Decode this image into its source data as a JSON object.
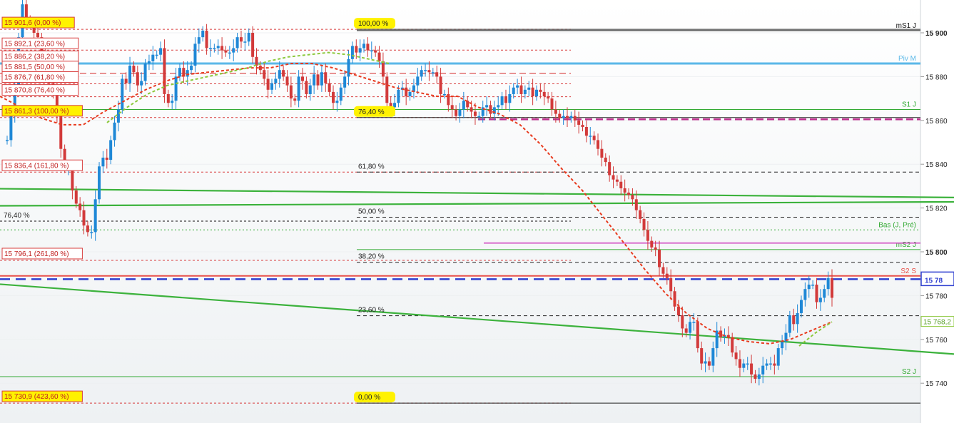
{
  "chart_data": {
    "type": "candlestick",
    "ylim": [
      15730,
      15918
    ],
    "y_ticks": [
      {
        "value": 15900,
        "label": "15 900",
        "bold": true
      },
      {
        "value": 15880,
        "label": "15 880",
        "bold": false
      },
      {
        "value": 15860,
        "label": "15 860",
        "bold": false
      },
      {
        "value": 15840,
        "label": "15 840",
        "bold": false
      },
      {
        "value": 15820,
        "label": "15 820",
        "bold": false
      },
      {
        "value": 15800,
        "label": "15 800",
        "bold": true
      },
      {
        "value": 15780,
        "label": "15 780",
        "bold": false
      },
      {
        "value": 15760,
        "label": "15 760",
        "bold": false
      },
      {
        "value": 15740,
        "label": "15 740",
        "bold": false
      }
    ],
    "current_price_label": "15 78",
    "ma_end_label": "15 768,2",
    "pivot_levels": [
      {
        "name": "mS1 J",
        "value": 15901,
        "color": "#111111"
      },
      {
        "name": "Piv M",
        "value": 15886,
        "color": "#5bb8e8"
      },
      {
        "name": "S1 J",
        "value": 15865,
        "color": "#33aa33"
      },
      {
        "name": "Bas (J, Pré)",
        "value": 15810,
        "color": "#33aa33"
      },
      {
        "name": "mS2 J",
        "value": 15801,
        "color": "#33aa33"
      },
      {
        "name": "S2 S",
        "value": 15789,
        "color": "#e8504a"
      },
      {
        "name": "S2 J",
        "value": 15743,
        "color": "#33aa33"
      }
    ],
    "fib_left_labels": [
      {
        "text": "15 901,6 (0,00 %)",
        "value": 15901.6,
        "highlight": true
      },
      {
        "text": "15 892,1 (23,60 %)",
        "value": 15892.1,
        "highlight": false
      },
      {
        "text": "15 886,2 (38,20 %)",
        "value": 15886.2,
        "highlight": false
      },
      {
        "text": "15 881,5 (50,00 %)",
        "value": 15881.5,
        "highlight": false
      },
      {
        "text": "15 876,7 (61,80 %)",
        "value": 15876.7,
        "highlight": false
      },
      {
        "text": "15 870,8 (76,40 %)",
        "value": 15870.8,
        "highlight": false
      },
      {
        "text": "15 861,3 (100,00 %)",
        "value": 15861.3,
        "highlight": true
      },
      {
        "text": "15 836,4 (161,80 %)",
        "value": 15836.4,
        "highlight": false
      },
      {
        "text": "15 796,1 (261,80 %)",
        "value": 15796.1,
        "highlight": false
      },
      {
        "text": "15 730,9 (423,60 %)",
        "value": 15730.9,
        "highlight": true
      }
    ],
    "fib_mid_labels": [
      {
        "text": "100,00 %",
        "value": 15901.6,
        "highlight": true
      },
      {
        "text": "76,40 %",
        "value": 15861.3,
        "highlight": true
      },
      {
        "text": "61,80 %",
        "value": 15836.4,
        "highlight": false
      },
      {
        "text": "50,00 %",
        "value": 15815.8,
        "highlight": false
      },
      {
        "text": "38,20 %",
        "value": 15795.2,
        "highlight": false
      },
      {
        "text": "23,60 %",
        "value": 15770.8,
        "highlight": false
      },
      {
        "text": "0,00 %",
        "value": 15730.9,
        "highlight": true
      }
    ],
    "left_extra_label": {
      "text": "76,40 %",
      "value": 15814.0
    },
    "trendlines": [
      {
        "from": [
          0,
          15828.8
        ],
        "to": [
          1,
          15824.8
        ]
      },
      {
        "from": [
          0,
          15821.0
        ],
        "to": [
          1,
          15822.8
        ]
      },
      {
        "from": [
          0,
          15785.2
        ],
        "to": [
          1,
          15753.3
        ]
      }
    ],
    "series": [
      {
        "name": "candles",
        "open": [
          15851,
          15851,
          15863,
          15874,
          15898,
          15913,
          15906,
          15904,
          15900,
          15898,
          15891,
          15884,
          15877,
          15872,
          15862,
          15847,
          15838,
          15838,
          15828,
          15822,
          15819,
          15812,
          15809,
          15809,
          15824,
          15839,
          15843,
          15842,
          15851,
          15859,
          15865,
          15879,
          15877,
          15885,
          15882,
          15876,
          15878,
          15886,
          15887,
          15890,
          15890,
          15893,
          15872,
          15868,
          15869,
          15880,
          15884,
          15880,
          15883,
          15885,
          15895,
          15898,
          15901,
          15893,
          15893,
          15893,
          15894,
          15892,
          15891,
          15891,
          15893,
          15898,
          15896,
          15896,
          15900,
          15889,
          15885,
          15883,
          15879,
          15874,
          15877,
          15879,
          15883,
          15880,
          15876,
          15870,
          15869,
          15880,
          15878,
          15872,
          15876,
          15881,
          15876,
          15882,
          15877,
          15873,
          15868,
          15869,
          15875,
          15880,
          15888,
          15894,
          15891,
          15893,
          15895,
          15892,
          15892,
          15891,
          15887,
          15880,
          15868,
          15866,
          15868,
          15874,
          15875,
          15871,
          15873,
          15876,
          15880,
          15883,
          15883,
          15882,
          15882,
          15880,
          15872,
          15872,
          15867,
          15865,
          15862,
          15865,
          15869,
          15866,
          15864,
          15862,
          15862,
          15866,
          15867,
          15863,
          15866,
          15867,
          15871,
          15868,
          15872,
          15875,
          15876,
          15872,
          15874,
          15875,
          15871,
          15874,
          15873,
          15871,
          15870,
          15865,
          15863,
          15861,
          15862,
          15861,
          15862,
          15860,
          15858,
          15857,
          15853,
          15853,
          15851,
          15847,
          15843,
          15841,
          15835,
          15833,
          15832,
          15829,
          15827,
          15826,
          15824,
          15819,
          15815,
          15810,
          15805,
          15802,
          15801,
          15793,
          15790,
          15788,
          15782,
          15775,
          15771,
          15765,
          15763,
          15768,
          15768,
          15756,
          15749,
          15750,
          15748,
          15756,
          15764,
          15761,
          15762,
          15761,
          15754,
          15751,
          15747,
          15749,
          15749,
          15744,
          15742,
          15744,
          15748,
          15749,
          15749,
          15748,
          15756,
          15759,
          15763,
          15771,
          15767,
          15772,
          15778,
          15783,
          15785,
          15785,
          15777,
          15779,
          15783,
          15788
        ],
        "close": [
          15851,
          15863,
          15874,
          15898,
          15913,
          15906,
          15904,
          15900,
          15898,
          15891,
          15884,
          15877,
          15872,
          15862,
          15847,
          15838,
          15838,
          15828,
          15822,
          15819,
          15812,
          15809,
          15809,
          15824,
          15839,
          15843,
          15842,
          15851,
          15859,
          15865,
          15879,
          15877,
          15885,
          15882,
          15876,
          15878,
          15886,
          15887,
          15890,
          15890,
          15893,
          15872,
          15868,
          15869,
          15880,
          15884,
          15880,
          15883,
          15885,
          15895,
          15898,
          15901,
          15893,
          15893,
          15893,
          15894,
          15892,
          15891,
          15891,
          15893,
          15898,
          15896,
          15896,
          15900,
          15889,
          15885,
          15883,
          15879,
          15874,
          15877,
          15879,
          15883,
          15880,
          15876,
          15870,
          15869,
          15880,
          15878,
          15872,
          15876,
          15881,
          15876,
          15882,
          15877,
          15873,
          15868,
          15869,
          15875,
          15880,
          15888,
          15894,
          15891,
          15893,
          15895,
          15892,
          15892,
          15891,
          15887,
          15880,
          15868,
          15866,
          15868,
          15874,
          15875,
          15871,
          15873,
          15876,
          15880,
          15883,
          15883,
          15882,
          15882,
          15880,
          15872,
          15872,
          15867,
          15865,
          15862,
          15865,
          15869,
          15866,
          15864,
          15862,
          15862,
          15866,
          15867,
          15863,
          15866,
          15867,
          15871,
          15868,
          15872,
          15875,
          15876,
          15872,
          15874,
          15875,
          15871,
          15874,
          15873,
          15871,
          15870,
          15865,
          15863,
          15861,
          15862,
          15861,
          15862,
          15860,
          15858,
          15857,
          15853,
          15853,
          15851,
          15847,
          15843,
          15841,
          15835,
          15833,
          15832,
          15829,
          15827,
          15826,
          15824,
          15819,
          15815,
          15810,
          15805,
          15802,
          15801,
          15793,
          15790,
          15788,
          15782,
          15775,
          15771,
          15765,
          15763,
          15768,
          15768,
          15756,
          15749,
          15750,
          15748,
          15756,
          15764,
          15761,
          15762,
          15761,
          15754,
          15751,
          15747,
          15749,
          15749,
          15744,
          15742,
          15744,
          15748,
          15749,
          15749,
          15748,
          15756,
          15759,
          15763,
          15771,
          15767,
          15772,
          15778,
          15783,
          15785,
          15785,
          15777,
          15779,
          15783,
          15788,
          15779
        ]
      },
      {
        "name": "moving-average-red",
        "values": [
          15871,
          15866,
          15861,
          15858,
          15858,
          15864,
          15869,
          15874,
          15878,
          15881,
          15882,
          15883,
          15884,
          15884,
          15886,
          15886,
          15884,
          15881,
          15878,
          15875,
          15873,
          15871,
          15871,
          15866,
          15863,
          15858,
          15849,
          15838,
          15828,
          15816,
          15804,
          15792,
          15781,
          15772,
          15765,
          15761,
          15759,
          15758,
          15760,
          15764,
          15768
        ]
      },
      {
        "name": "moving-average-green",
        "values": [
          15859,
          15866,
          15872,
          15876,
          15878,
          15880,
          15882,
          15884,
          15887,
          15889,
          15890,
          15891,
          15890,
          15888,
          15886
        ]
      },
      {
        "name": "moving-average-green-end",
        "values": [
          15757,
          15763,
          15768
        ]
      }
    ]
  }
}
